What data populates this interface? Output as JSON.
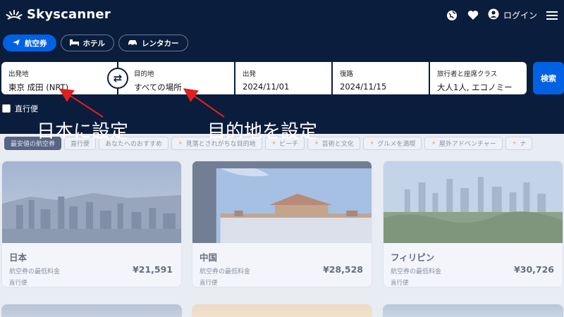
{
  "header": {
    "brand": "Skyscanner",
    "login_label": "ログイン",
    "icons": [
      "globe-icon",
      "heart-icon",
      "user-icon",
      "menu-icon"
    ]
  },
  "tabs": [
    {
      "label": "航空券",
      "icon": "plane-icon",
      "active": true
    },
    {
      "label": "ホテル",
      "icon": "bed-icon",
      "active": false
    },
    {
      "label": "レンタカー",
      "icon": "car-icon",
      "active": false
    }
  ],
  "search": {
    "origin": {
      "label": "出発地",
      "value": "東京 成田 (NRT)"
    },
    "destination": {
      "label": "目的地",
      "value": "すべての場所"
    },
    "depart": {
      "label": "出発",
      "value": "2024/11/01"
    },
    "return": {
      "label": "復路",
      "value": "2024/11/15"
    },
    "travellers": {
      "label": "旅行者と座席クラス",
      "value": "大人1人, エコノミー"
    },
    "button_label": "検索",
    "direct_label": "直行便"
  },
  "annotations": {
    "origin_note": "日本に設定",
    "destination_note": "目的地を設定"
  },
  "chips": [
    {
      "label": "最安値の航空券",
      "active": true,
      "star": false
    },
    {
      "label": "直行便",
      "active": false,
      "star": false
    },
    {
      "label": "あなたへのおすすめ",
      "active": false,
      "star": false
    },
    {
      "label": "見落とされがちな目的地",
      "active": false,
      "star": true
    },
    {
      "label": "ビーチ",
      "active": false,
      "star": true
    },
    {
      "label": "芸術と文化",
      "active": false,
      "star": true
    },
    {
      "label": "グルメを満喫",
      "active": false,
      "star": true
    },
    {
      "label": "屋外アドベンチャー",
      "active": false,
      "star": true
    },
    {
      "label": "ナ",
      "active": false,
      "star": true
    }
  ],
  "cards": [
    {
      "name": "日本",
      "sub": "航空券の最低料金",
      "price": "¥21,591",
      "direct": "直行便"
    },
    {
      "name": "中国",
      "sub": "航空券の最低料金",
      "price": "¥28,528",
      "direct": "直行便"
    },
    {
      "name": "フィリピン",
      "sub": "航空券の最低料金",
      "price": "¥30,726",
      "direct": "直行便"
    }
  ],
  "colors": {
    "background": "#0a1d3c",
    "accent": "#0062e3",
    "annotation_arrow": "#e02020"
  }
}
